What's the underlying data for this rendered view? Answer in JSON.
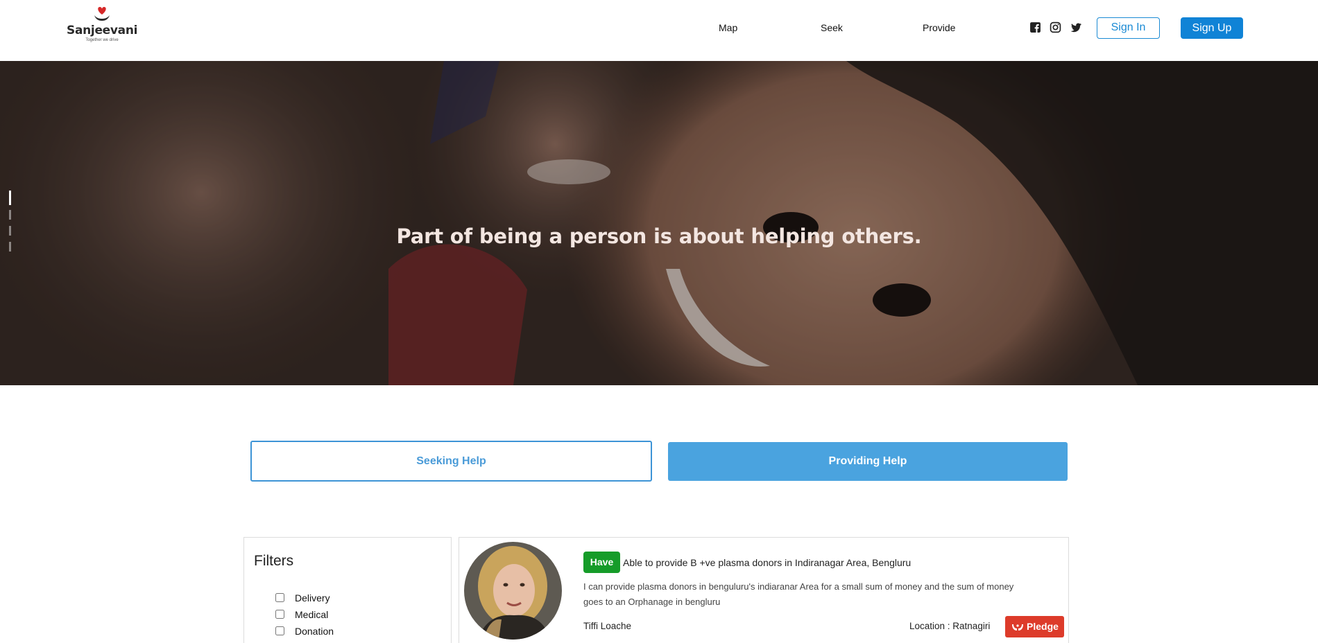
{
  "brand": {
    "name": "Sanjeevani",
    "tagline": "Together we drive",
    "accent": "#1083d6",
    "logo_heart": "#d62828"
  },
  "nav": {
    "items": [
      "Map",
      "Seek",
      "Provide"
    ]
  },
  "social": {
    "icons": [
      "facebook-icon",
      "instagram-icon",
      "twitter-icon"
    ]
  },
  "auth": {
    "sign_in": "Sign In",
    "sign_up": "Sign Up"
  },
  "hero": {
    "quote": "Part of being a person is about helping others.",
    "slides_total": 4,
    "active_slide": 1
  },
  "tabs": {
    "seeking": "Seeking Help",
    "providing": "Providing Help",
    "active": "providing"
  },
  "filters": {
    "title": "Filters",
    "options": [
      "Delivery",
      "Medical",
      "Donation"
    ]
  },
  "post": {
    "badge": "Have",
    "badge_color": "#169c29",
    "title": "Able to provide B +ve plasma donors in Indiranagar Area, Bengluru",
    "description": "I can provide plasma donors in benguluru's indiaranar Area for a small sum of money and the sum of money goes to an Orphanage in bengluru",
    "user": "Tiffi Loache",
    "location": "Location : Ratnagiri",
    "pledge": "Pledge",
    "pledge_color": "#dd3b2a"
  }
}
